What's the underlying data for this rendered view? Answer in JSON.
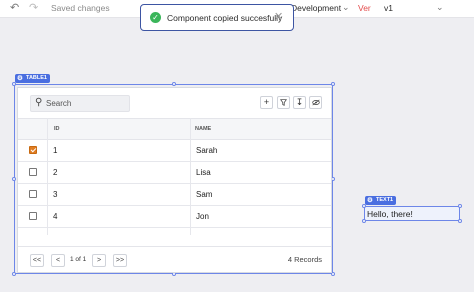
{
  "topbar": {
    "undo_icon": "undo-icon",
    "redo_icon": "redo-icon",
    "saved_text": "Saved changes",
    "environment": "Development",
    "version_label": "Ver",
    "version_value": "v1"
  },
  "toast": {
    "message": "Component copied succesfully",
    "close_icon": "close-icon"
  },
  "canvas": {
    "table_tag": "TABLE1",
    "text_tag": "TEXT1",
    "text_value": "Hello, there!"
  },
  "table": {
    "search_placeholder": "Search",
    "columns": [
      "ID",
      "NAME"
    ],
    "rows": [
      {
        "id": "1",
        "name": "Sarah",
        "checked": true
      },
      {
        "id": "2",
        "name": "Lisa",
        "checked": false
      },
      {
        "id": "3",
        "name": "Sam",
        "checked": false
      },
      {
        "id": "4",
        "name": "Jon",
        "checked": false
      }
    ],
    "page_info": "1 of 1",
    "records": "4 Records",
    "pager": {
      "first": "<<",
      "prev": "<",
      "next": ">",
      "last": ">>"
    }
  },
  "colors": {
    "accent": "#4a6ee0",
    "toast_border": "#3d55a3",
    "success": "#3ab55a",
    "checkbox_checked": "#e07d22",
    "version_red": "#e34b4b"
  }
}
